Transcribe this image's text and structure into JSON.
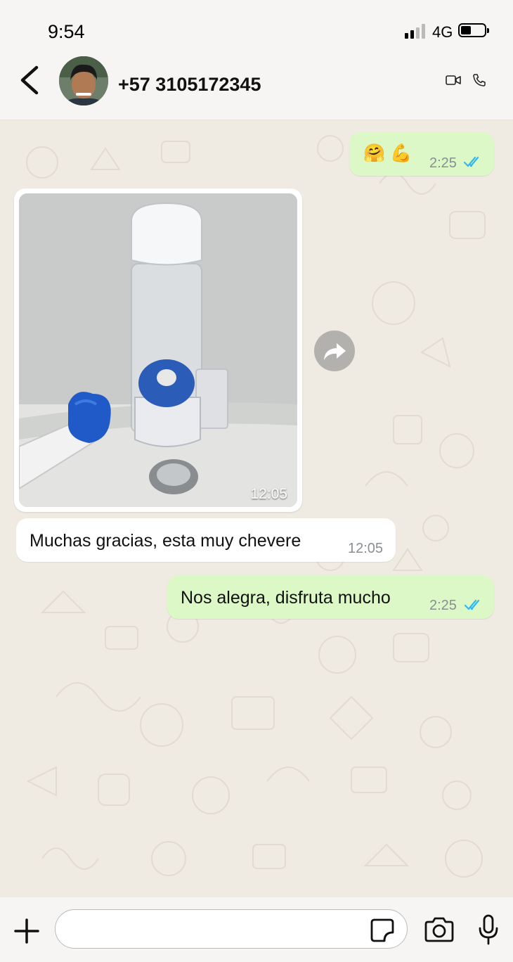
{
  "status_bar": {
    "time": "9:54",
    "network": "4G",
    "signal_bars": 2,
    "battery_level": 0.45
  },
  "header": {
    "contact_name": "+57 3105172345"
  },
  "messages": [
    {
      "direction": "out",
      "text": "🤗 💪",
      "time": "2:25",
      "status": "read"
    },
    {
      "direction": "in",
      "type": "image",
      "time": "12:05"
    },
    {
      "direction": "in",
      "text": "Muchas gracias, esta muy chevere",
      "time": "12:05"
    },
    {
      "direction": "out",
      "text": "Nos alegra, disfruta mucho",
      "time": "2:25",
      "status": "read"
    }
  ],
  "input": {
    "placeholder": "",
    "value": ""
  },
  "colors": {
    "outgoing_bubble": "#dcf8c6",
    "incoming_bubble": "#ffffff",
    "read_ticks": "#34b7f1",
    "chat_background": "#efeae2"
  }
}
